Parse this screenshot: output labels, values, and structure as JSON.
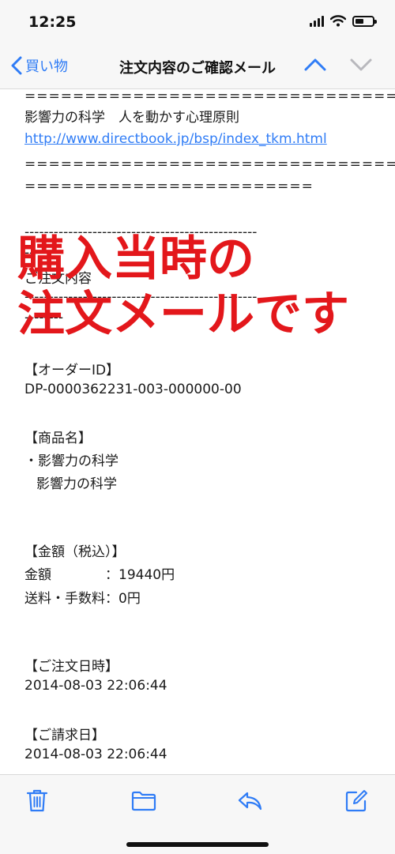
{
  "status": {
    "time": "12:25"
  },
  "nav": {
    "back_label": "買い物",
    "title": "注文内容のご確認メール"
  },
  "email": {
    "sep_long": "=====================================",
    "book_title": "影響力の科学　人を動かす心理原則",
    "book_url": "http://www.directbook.jp/bsp/index_tkm.html",
    "sep_short": "========================",
    "dash_long": "------------------------------------------------",
    "dash_short": "--------",
    "section_fragment": "ご注文内容",
    "order_id_label": "【オーダーID】",
    "order_id": "DP-0000362231-003-000000-00",
    "product_label": "【商品名】",
    "product_line1": "・影響力の科学",
    "product_line2": "影響力の科学",
    "amount_label": "【金額（税込）】",
    "amount_line": "金額　　　　：19440円",
    "shipping_line": "送料・手数料：0円",
    "order_date_label": "【ご注文日時】",
    "order_date": "2014-08-03 22:06:44",
    "billing_date_label": "【ご請求日】",
    "billing_date": "2014-08-03 22:06:44"
  },
  "overlay": {
    "line1": "購入当時の",
    "line2": "注文メールです"
  },
  "colors": {
    "accent": "#2f7cf6",
    "overlay_red": "#e3171b"
  },
  "icons": {
    "back": "chevron-left-icon",
    "up": "chevron-up-icon",
    "down": "chevron-down-icon",
    "trash": "trash-icon",
    "folder": "folder-icon",
    "reply": "reply-icon",
    "compose": "compose-icon"
  }
}
